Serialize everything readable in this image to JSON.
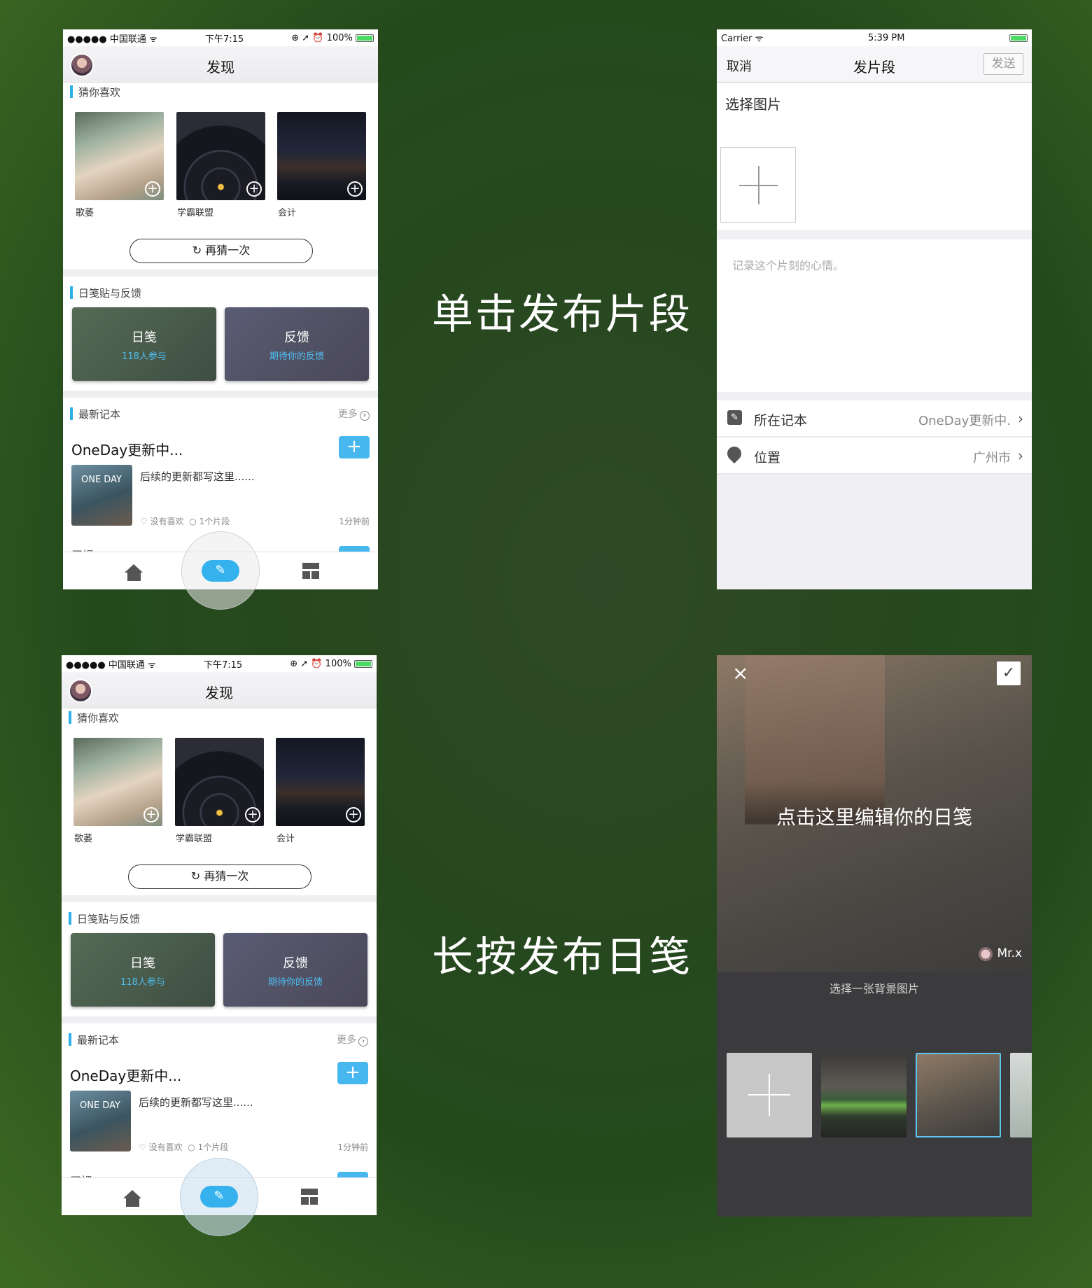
{
  "captions": {
    "tap": "单击发布片段",
    "longpress": "长按发布日笺"
  },
  "discover": {
    "status": {
      "carrier": "●●●●● 中国联通 ᯤ",
      "time": "下午7:15",
      "icons": "⊕ ➚ ⏰",
      "battery": "100%"
    },
    "title": "发现",
    "guess": {
      "section": "猜你喜欢",
      "items": [
        {
          "label": "歌萎"
        },
        {
          "label": "学霸联盟"
        },
        {
          "label": "会计"
        }
      ],
      "again": "再猜一次"
    },
    "stickers": {
      "section": "日笺贴与反馈",
      "cards": [
        {
          "title": "日笺",
          "sub": "118人参与"
        },
        {
          "title": "反馈",
          "sub": "期待你的反馈"
        }
      ]
    },
    "latest": {
      "section": "最新记本",
      "more": "更多",
      "notebook_title": "OneDay更新中...",
      "image_text": "ONE DAY",
      "desc": "后续的更新都写这里......",
      "likes": "没有喜欢",
      "count": "1个片段",
      "time": "1分钟前",
      "next_peek": "习惯"
    }
  },
  "editor": {
    "status": {
      "carrier": "Carrier ᯤ",
      "time": "5:39 PM"
    },
    "cancel": "取消",
    "title": "发片段",
    "send": "发送",
    "choose": "选择图片",
    "placeholder": "记录这个片刻的心情。",
    "notebook_label": "所在记本",
    "notebook_value": "OneDay更新中.",
    "location_label": "位置",
    "location_value": "广州市"
  },
  "diary": {
    "hint": "点击这里编辑你的日笺",
    "user": "Mr.x",
    "choose_bg": "选择一张背景图片"
  },
  "colors": {
    "accent": "#35b2ee",
    "section_bar": "#2eaee8",
    "card_left": "#4b5e4b",
    "card_right": "#53546a"
  }
}
